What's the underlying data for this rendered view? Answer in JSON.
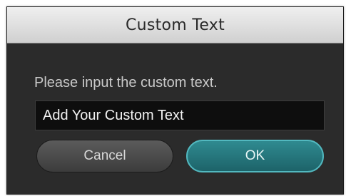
{
  "dialog": {
    "title": "Custom Text",
    "prompt": "Please input the custom text.",
    "input_value": "Add Your Custom Text",
    "cancel_label": "Cancel",
    "ok_label": "OK"
  },
  "colors": {
    "dialog_background": "#2b2b2b",
    "ok_accent": "#2f8a90",
    "input_background": "#0e0e0e"
  }
}
